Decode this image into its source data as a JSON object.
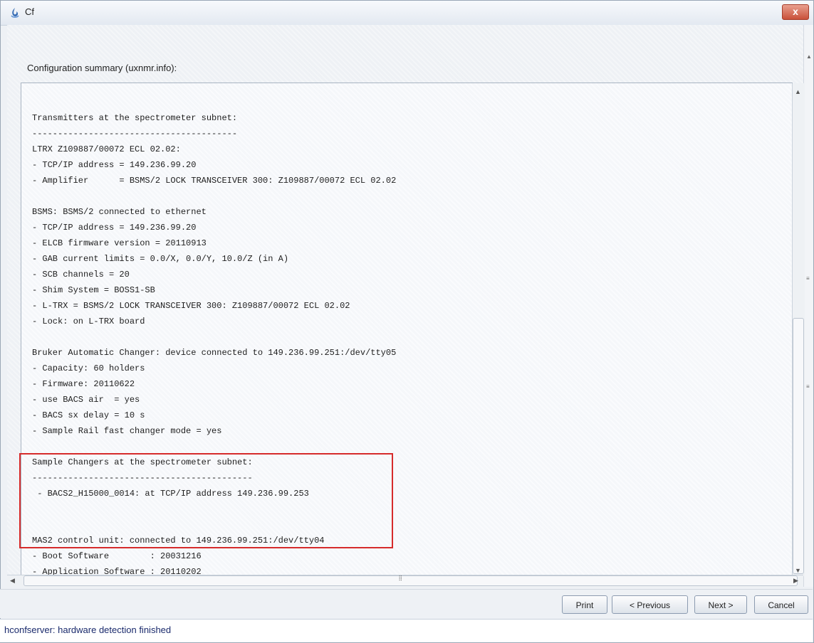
{
  "window": {
    "title": "Cf",
    "close_label": "x"
  },
  "summary_label": "Configuration summary (uxnmr.info):",
  "summary_text": [
    "Transmitters at the spectrometer subnet:",
    "----------------------------------------",
    "LTRX Z109887/00072 ECL 02.02:",
    "- TCP/IP address = 149.236.99.20",
    "- Amplifier      = BSMS/2 LOCK TRANSCEIVER 300: Z109887/00072 ECL 02.02",
    "",
    "BSMS: BSMS/2 connected to ethernet",
    "- TCP/IP address = 149.236.99.20",
    "- ELCB firmware version = 20110913",
    "- GAB current limits = 0.0/X, 0.0/Y, 10.0/Z (in A)",
    "- SCB channels = 20",
    "- Shim System = BOSS1-SB",
    "- L-TRX = BSMS/2 LOCK TRANSCEIVER 300: Z109887/00072 ECL 02.02",
    "- Lock: on L-TRX board",
    "",
    "Bruker Automatic Changer: device connected to 149.236.99.251:/dev/tty05",
    "- Capacity: 60 holders",
    "- Firmware: 20110622",
    "- use BACS air  = yes",
    "- BACS sx delay = 10 s",
    "- Sample Rail fast changer mode = yes",
    "",
    "Sample Changers at the spectrometer subnet:",
    "-------------------------------------------",
    " - BACS2_H15000_0014: at TCP/IP address 149.236.99.253",
    "",
    "",
    "MAS2 control unit: connected to 149.236.99.251:/dev/tty04",
    "- Boot Software        : 20031216",
    "- Application Software : 20110202"
  ],
  "buttons": {
    "print": "Print",
    "previous": "< Previous",
    "next": "Next >",
    "cancel": "Cancel"
  },
  "status": "hconfserver: hardware detection finished",
  "colors": {
    "highlight_border": "#d62b2b",
    "status_text": "#1a2a6c"
  }
}
